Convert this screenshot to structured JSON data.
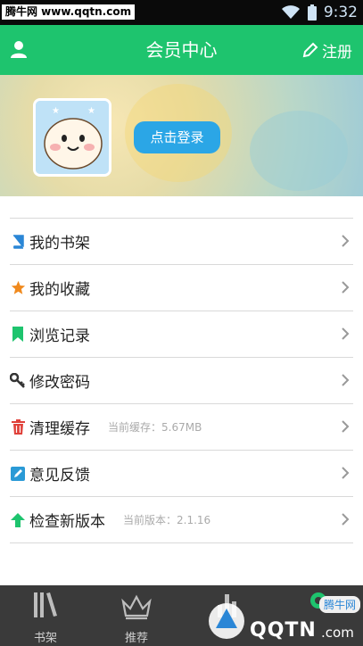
{
  "statusbar": {
    "watermark": "腾牛网 www.qqtn.com",
    "time": "9:32"
  },
  "header": {
    "title": "会员中心",
    "register_label": "注册"
  },
  "profile": {
    "login_button": "点击登录"
  },
  "menu": [
    {
      "label": "我的书架",
      "sub": "",
      "icon": "book-icon",
      "color": "#2a86d6"
    },
    {
      "label": "我的收藏",
      "sub": "",
      "icon": "star-icon",
      "color": "#f08a1e"
    },
    {
      "label": "浏览记录",
      "sub": "",
      "icon": "bookmark-icon",
      "color": "#1ec46e"
    },
    {
      "label": "修改密码",
      "sub": "",
      "icon": "key-icon",
      "color": "#333333"
    },
    {
      "label": "清理缓存",
      "sub": "当前缓存：5.67MB",
      "icon": "trash-icon",
      "color": "#e0413a"
    },
    {
      "label": "意见反馈",
      "sub": "",
      "icon": "edit-icon",
      "color": "#2a9ad6"
    },
    {
      "label": "检查新版本",
      "sub": "当前版本：2.1.16",
      "icon": "arrow-up-icon",
      "color": "#1ec46e"
    }
  ],
  "tabbar": {
    "tabs": [
      {
        "label": "书架"
      },
      {
        "label": "推荐"
      }
    ]
  },
  "watermark2": {
    "brand": "QQTN",
    "domain": ".com",
    "site": "腾牛网"
  }
}
